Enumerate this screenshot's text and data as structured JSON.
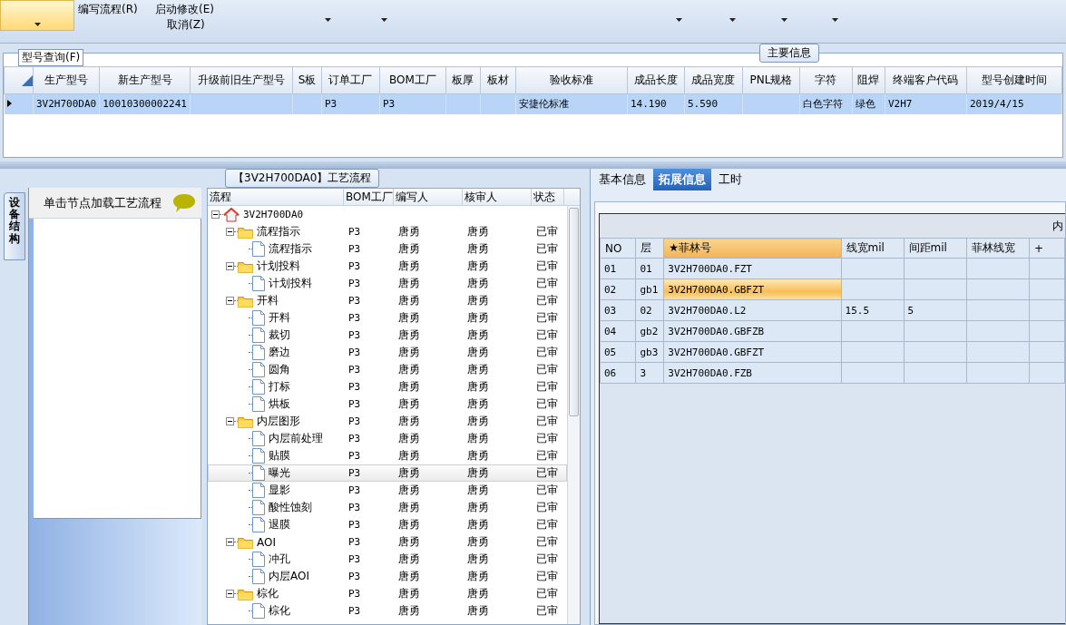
{
  "ribbon": {
    "menu_items": [
      {
        "label": "编写流程(R)"
      },
      {
        "label": "启动修改(E)"
      },
      {
        "label": "取消(Z)"
      }
    ]
  },
  "query_panel": {
    "legend": "型号查询(F)",
    "tab": "主要信息",
    "columns": [
      "生产型号",
      "新生产型号",
      "升级前旧生产型号",
      "S板",
      "订单工厂",
      "BOM工厂",
      "板厚",
      "板材",
      "验收标准",
      "成品长度",
      "成品宽度",
      "PNL规格",
      "字符",
      "阻焊",
      "终端客户代码",
      "型号创建时间"
    ],
    "rows": [
      {
        "selected": true,
        "cells": [
          "3V2H700DA0",
          "10010300002241",
          "",
          "",
          "P3",
          "P3",
          "",
          "",
          "安捷伦标准",
          "14.190",
          "5.590",
          "",
          "白色字符",
          "绿色",
          "V2H7",
          "2019/4/15"
        ]
      }
    ]
  },
  "process_panel": {
    "title": "【3V2H700DA0】工艺流程",
    "side_tab": "设备结构",
    "hint": "单击节点加载工艺流程",
    "columns": [
      "流程",
      "BOM工厂",
      "编写人",
      "核审人",
      "状态"
    ],
    "tree": [
      {
        "kind": "home",
        "name": "3V2H700DA0",
        "expanded": true,
        "selected": false,
        "children": [
          {
            "kind": "folder",
            "name": "流程指示",
            "bom": "P3",
            "writer": "唐勇",
            "reviewer": "唐勇",
            "status": "已审",
            "expanded": true,
            "selected": false,
            "children": [
              {
                "kind": "file",
                "name": "流程指示",
                "bom": "P3",
                "writer": "唐勇",
                "reviewer": "唐勇",
                "status": "已审",
                "selected": false
              }
            ]
          },
          {
            "kind": "folder",
            "name": "计划投料",
            "bom": "P3",
            "writer": "唐勇",
            "reviewer": "唐勇",
            "status": "已审",
            "expanded": true,
            "selected": false,
            "children": [
              {
                "kind": "file",
                "name": "计划投料",
                "bom": "P3",
                "writer": "唐勇",
                "reviewer": "唐勇",
                "status": "已审",
                "selected": false
              }
            ]
          },
          {
            "kind": "folder",
            "name": "开料",
            "bom": "P3",
            "writer": "唐勇",
            "reviewer": "唐勇",
            "status": "已审",
            "expanded": true,
            "selected": false,
            "children": [
              {
                "kind": "file",
                "name": "开料",
                "bom": "P3",
                "writer": "唐勇",
                "reviewer": "唐勇",
                "status": "已审",
                "selected": false
              },
              {
                "kind": "file",
                "name": "裁切",
                "bom": "P3",
                "writer": "唐勇",
                "reviewer": "唐勇",
                "status": "已审",
                "selected": false
              },
              {
                "kind": "file",
                "name": "磨边",
                "bom": "P3",
                "writer": "唐勇",
                "reviewer": "唐勇",
                "status": "已审",
                "selected": false
              },
              {
                "kind": "file",
                "name": "圆角",
                "bom": "P3",
                "writer": "唐勇",
                "reviewer": "唐勇",
                "status": "已审",
                "selected": false
              },
              {
                "kind": "file",
                "name": "打标",
                "bom": "P3",
                "writer": "唐勇",
                "reviewer": "唐勇",
                "status": "已审",
                "selected": false
              },
              {
                "kind": "file",
                "name": "烘板",
                "bom": "P3",
                "writer": "唐勇",
                "reviewer": "唐勇",
                "status": "已审",
                "selected": false
              }
            ]
          },
          {
            "kind": "folder",
            "name": "内层图形",
            "bom": "P3",
            "writer": "唐勇",
            "reviewer": "唐勇",
            "status": "已审",
            "expanded": true,
            "selected": false,
            "children": [
              {
                "kind": "file",
                "name": "内层前处理",
                "bom": "P3",
                "writer": "唐勇",
                "reviewer": "唐勇",
                "status": "已审",
                "selected": false
              },
              {
                "kind": "file",
                "name": "贴膜",
                "bom": "P3",
                "writer": "唐勇",
                "reviewer": "唐勇",
                "status": "已审",
                "selected": false
              },
              {
                "kind": "file",
                "name": "曝光",
                "bom": "P3",
                "writer": "唐勇",
                "reviewer": "唐勇",
                "status": "已审",
                "selected": true
              },
              {
                "kind": "file",
                "name": "显影",
                "bom": "P3",
                "writer": "唐勇",
                "reviewer": "唐勇",
                "status": "已审",
                "selected": false
              },
              {
                "kind": "file",
                "name": "酸性蚀刻",
                "bom": "P3",
                "writer": "唐勇",
                "reviewer": "唐勇",
                "status": "已审",
                "selected": false
              },
              {
                "kind": "file",
                "name": "退膜",
                "bom": "P3",
                "writer": "唐勇",
                "reviewer": "唐勇",
                "status": "已审",
                "selected": false
              }
            ]
          },
          {
            "kind": "folder",
            "name": "AOI",
            "bom": "P3",
            "writer": "唐勇",
            "reviewer": "唐勇",
            "status": "已审",
            "expanded": true,
            "selected": false,
            "children": [
              {
                "kind": "file",
                "name": "冲孔",
                "bom": "P3",
                "writer": "唐勇",
                "reviewer": "唐勇",
                "status": "已审",
                "selected": false
              },
              {
                "kind": "file",
                "name": "内层AOI",
                "bom": "P3",
                "writer": "唐勇",
                "reviewer": "唐勇",
                "status": "已审",
                "selected": false
              }
            ]
          },
          {
            "kind": "folder",
            "name": "棕化",
            "bom": "P3",
            "writer": "唐勇",
            "reviewer": "唐勇",
            "status": "已审",
            "expanded": true,
            "selected": false,
            "children": [
              {
                "kind": "file",
                "name": "棕化",
                "bom": "P3",
                "writer": "唐勇",
                "reviewer": "唐勇",
                "status": "已审",
                "selected": false
              }
            ]
          }
        ]
      }
    ]
  },
  "detail_panel": {
    "tabs": [
      {
        "label": "基本信息",
        "selected": false
      },
      {
        "label": "拓展信息",
        "selected": true
      },
      {
        "label": "工时",
        "selected": false
      }
    ],
    "group_header": "内",
    "columns": [
      {
        "label": "NO",
        "selected": false
      },
      {
        "label": "层",
        "selected": false
      },
      {
        "label": "★菲林号",
        "selected": true
      },
      {
        "label": "线宽mil",
        "selected": false
      },
      {
        "label": "间距mil",
        "selected": false
      },
      {
        "label": "菲林线宽",
        "selected": false
      },
      {
        "label": "+",
        "selected": false
      }
    ],
    "rows": [
      {
        "selected": false,
        "cells": [
          "01",
          "01",
          "3V2H700DA0.FZT",
          "",
          "",
          "",
          ""
        ]
      },
      {
        "selected": true,
        "cells": [
          "02",
          "gb1",
          "3V2H700DA0.GBFZT",
          "",
          "",
          "",
          ""
        ]
      },
      {
        "selected": false,
        "cells": [
          "03",
          "02",
          "3V2H700DA0.L2",
          "15.5",
          "5",
          "",
          ""
        ]
      },
      {
        "selected": false,
        "cells": [
          "04",
          "gb2",
          "3V2H700DA0.GBFZB",
          "",
          "",
          "",
          ""
        ]
      },
      {
        "selected": false,
        "cells": [
          "05",
          "gb3",
          "3V2H700DA0.GBFZT",
          "",
          "",
          "",
          ""
        ]
      },
      {
        "selected": false,
        "cells": [
          "06",
          "3",
          "3V2H700DA0.FZB",
          "",
          "",
          "",
          ""
        ]
      }
    ]
  }
}
